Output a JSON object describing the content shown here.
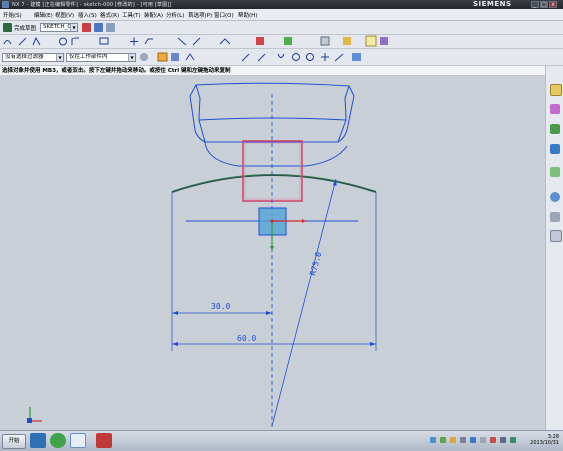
{
  "window": {
    "title": "NX 7 - 建模 [正在编辑零件] - sketch-000 [修改的] - [可用 [草图]]",
    "brand": "SIEMENS",
    "min_label": "_",
    "max_label": "□",
    "close_label": "x"
  },
  "menu": [
    "开始(S)",
    "编辑(E)",
    "视图(V)",
    "插入(S)",
    "格式(R)",
    "工具(T)",
    "装配(A)",
    "分析(L)",
    "首选项(P)",
    "窗口(O)",
    "帮助(H)"
  ],
  "sketch_toolbar": {
    "finish_label": "完成草图",
    "sketch_name": "SKETCH_004"
  },
  "filter_toolbar": {
    "selection_filter": "没有选择过滤器",
    "scope": "仅在工作部件内"
  },
  "hint": "选择对象并使用 MB3，或者双击。按下左键并拖动来移动。或按住 Ctrl 键和左键拖动来复制",
  "dimensions": {
    "horizontal_small": "30.0",
    "horizontal_large": "60.0",
    "radius": "R75.0"
  },
  "taskbar": {
    "start_label": "开始",
    "time": "3:28",
    "date": "2013/10/31"
  },
  "colors": {
    "sketch_blue": "#1f4fd0",
    "constraint_pink": "#d0406a",
    "arc_green": "#2e7d4a",
    "selection_cyan": "#4aa0d8"
  }
}
